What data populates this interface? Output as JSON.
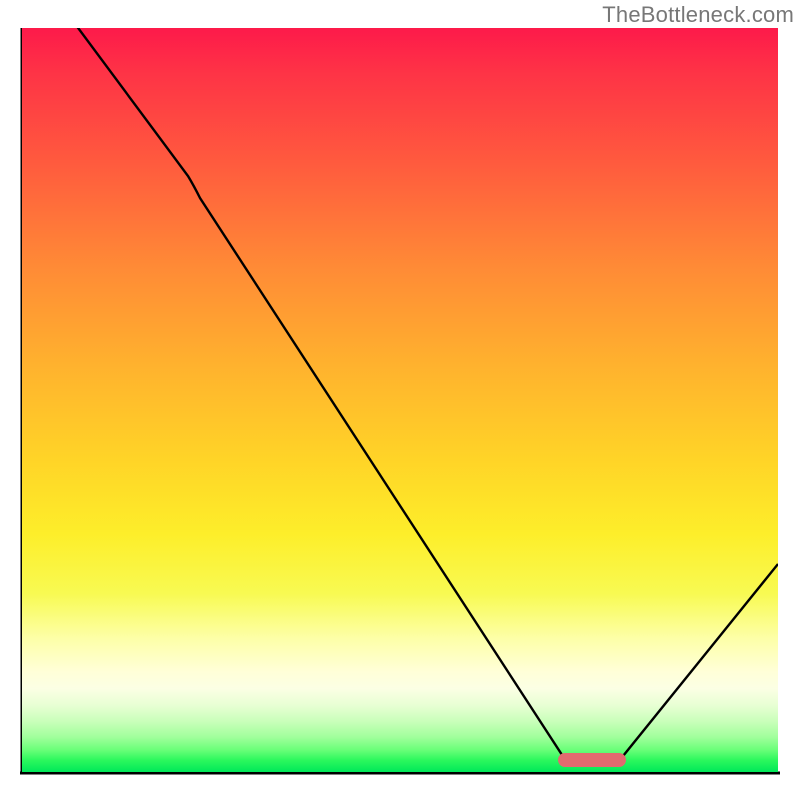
{
  "watermark": "TheBottleneck.com",
  "colors": {
    "axis": "#000000",
    "curve": "#000000",
    "marker": "#e26a6f",
    "gradient_stops": [
      {
        "pct": 0,
        "hex": "#fd1a4a"
      },
      {
        "pct": 6,
        "hex": "#fe3346"
      },
      {
        "pct": 18,
        "hex": "#ff5a3e"
      },
      {
        "pct": 32,
        "hex": "#ff8a36"
      },
      {
        "pct": 45,
        "hex": "#ffb12e"
      },
      {
        "pct": 58,
        "hex": "#ffd427"
      },
      {
        "pct": 68,
        "hex": "#fdee2a"
      },
      {
        "pct": 76,
        "hex": "#f8fa52"
      },
      {
        "pct": 82,
        "hex": "#fdffa7"
      },
      {
        "pct": 86.5,
        "hex": "#ffffd8"
      },
      {
        "pct": 88.8,
        "hex": "#fbffe4"
      },
      {
        "pct": 91,
        "hex": "#e8ffd4"
      },
      {
        "pct": 93.2,
        "hex": "#c9ffba"
      },
      {
        "pct": 95.3,
        "hex": "#a1ff9c"
      },
      {
        "pct": 97,
        "hex": "#6bff79"
      },
      {
        "pct": 98.4,
        "hex": "#2cf85d"
      },
      {
        "pct": 100,
        "hex": "#00e859"
      }
    ]
  },
  "chart_data": {
    "type": "line",
    "title": "",
    "xlabel": "",
    "ylabel": "",
    "xlim": [
      0,
      100
    ],
    "ylim": [
      0,
      100
    ],
    "series": [
      {
        "name": "bottleneck-curve",
        "x": [
          6,
          22,
          72,
          79,
          100
        ],
        "y": [
          102,
          80,
          1.5,
          1.5,
          28
        ]
      }
    ],
    "annotations": [
      {
        "name": "optimal-marker",
        "x_start": 71,
        "x_end": 80,
        "y": 1.5
      }
    ],
    "gradient_axis": "y",
    "gradient_meaning": "top=worst (red), bottom=best (green)"
  }
}
